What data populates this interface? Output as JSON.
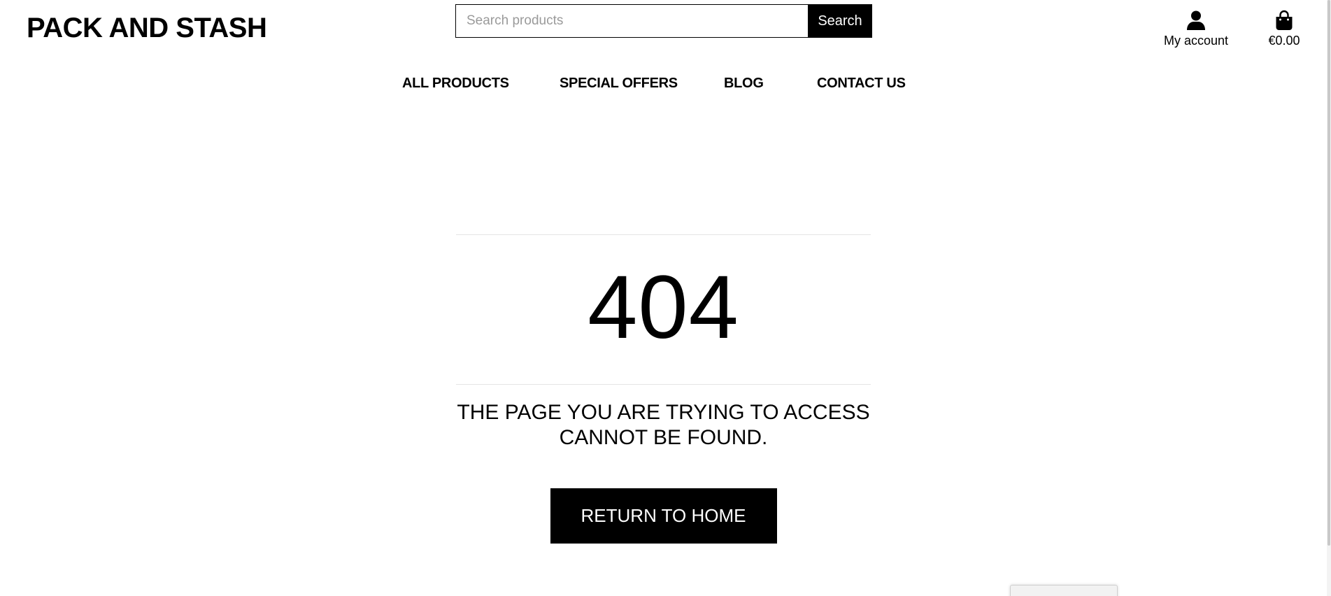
{
  "header": {
    "logo": "PACK AND STASH",
    "search": {
      "placeholder": "Search products",
      "button_label": "Search"
    },
    "account": {
      "icon": "user-icon",
      "label": "My account"
    },
    "cart": {
      "icon": "shopping-bag-icon",
      "total": "€0.00"
    }
  },
  "nav": {
    "items": [
      {
        "label": "ALL PRODUCTS"
      },
      {
        "label": "SPECIAL OFFERS"
      },
      {
        "label": "BLOG"
      },
      {
        "label": "CONTACT US"
      }
    ]
  },
  "error": {
    "code": "404",
    "message": "THE PAGE YOU ARE TRYING TO ACCESS CANNOT BE FOUND.",
    "button_label": "RETURN TO HOME"
  }
}
